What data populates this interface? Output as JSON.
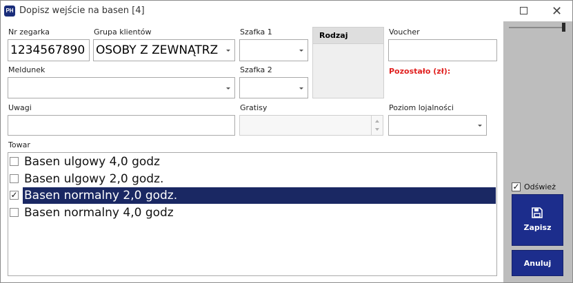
{
  "window": {
    "app_icon_text": "PH",
    "title": "Dopisz wejście na basen [4]"
  },
  "labels": {
    "nr_zegarka": "Nr zegarka",
    "grupa_klientow": "Grupa klientów",
    "szafka1": "Szafka 1",
    "rodzaj": "Rodzaj",
    "voucher": "Voucher",
    "meldunek": "Meldunek",
    "szafka2": "Szafka 2",
    "pozostalo": "Pozostało (zł):",
    "uwagi": "Uwagi",
    "gratisy": "Gratisy",
    "poziom_lojalnosci": "Poziom lojalności",
    "towar": "Towar"
  },
  "fields": {
    "nr_zegarka": "1234567890",
    "grupa_klientow": "OSOBY Z ZEWNĄTRZ",
    "szafka1": "",
    "voucher": "",
    "meldunek": "",
    "szafka2": "",
    "uwagi": "",
    "gratisy": "",
    "poziom_lojalnosci": ""
  },
  "towar_items": [
    {
      "label": "Basen ulgowy 4,0 godz",
      "checked": false,
      "selected": false
    },
    {
      "label": "Basen ulgowy 2,0 godz.",
      "checked": false,
      "selected": false
    },
    {
      "label": "Basen normalny 2,0 godz.",
      "checked": true,
      "selected": true
    },
    {
      "label": "Basen normalny 4,0 godz",
      "checked": false,
      "selected": false
    }
  ],
  "sidebar": {
    "refresh_label": "Odśwież",
    "refresh_checked": true,
    "save_label": "Zapisz",
    "cancel_label": "Anuluj"
  },
  "colors": {
    "selection": "#1a2863",
    "button": "#1c2d8c",
    "warning_text": "#e0201f"
  }
}
